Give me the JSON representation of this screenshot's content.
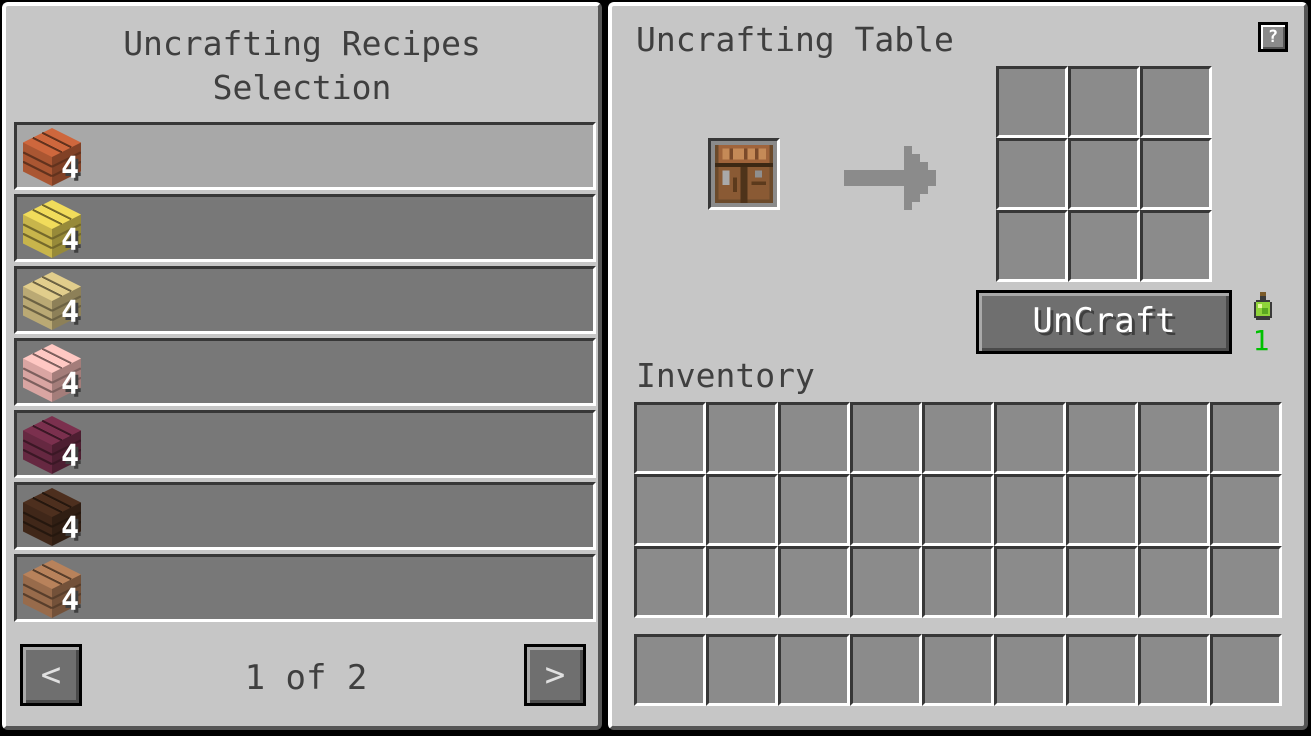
{
  "left_panel": {
    "title_line1": "Uncrafting Recipes",
    "title_line2": "Selection",
    "recipes": [
      {
        "item": "acacia-planks-icon",
        "count": "4",
        "color": "#b35a35",
        "selected": true
      },
      {
        "item": "bamboo-planks-icon",
        "count": "4",
        "color": "#d2bf4f",
        "selected": false
      },
      {
        "item": "birch-planks-icon",
        "count": "4",
        "color": "#c4b27a",
        "selected": false
      },
      {
        "item": "cherry-planks-icon",
        "count": "4",
        "color": "#e4aeaa",
        "selected": false
      },
      {
        "item": "crimson-planks-icon",
        "count": "4",
        "color": "#6b2a44",
        "selected": false
      },
      {
        "item": "dark-oak-planks-icon",
        "count": "4",
        "color": "#43291a",
        "selected": false
      },
      {
        "item": "jungle-planks-icon",
        "count": "4",
        "color": "#a0714f",
        "selected": false
      }
    ],
    "prev_label": "<",
    "next_label": ">",
    "page_text": "1 of 2"
  },
  "right_panel": {
    "title": "Uncrafting Table",
    "help_label": "?",
    "input_item": "crafting-table-icon",
    "arrow_icon": "right-arrow-icon",
    "uncraft_label": "UnCraft",
    "xp_icon": "experience-bottle-icon",
    "xp_cost": "1",
    "inventory_label": "Inventory"
  },
  "colors": {
    "panel_bg": "#c6c6c6",
    "slot_bg": "#8b8b8b",
    "row_bg": "#787878",
    "row_selected_bg": "#a8a8a8",
    "xp_green": "#00c000"
  }
}
